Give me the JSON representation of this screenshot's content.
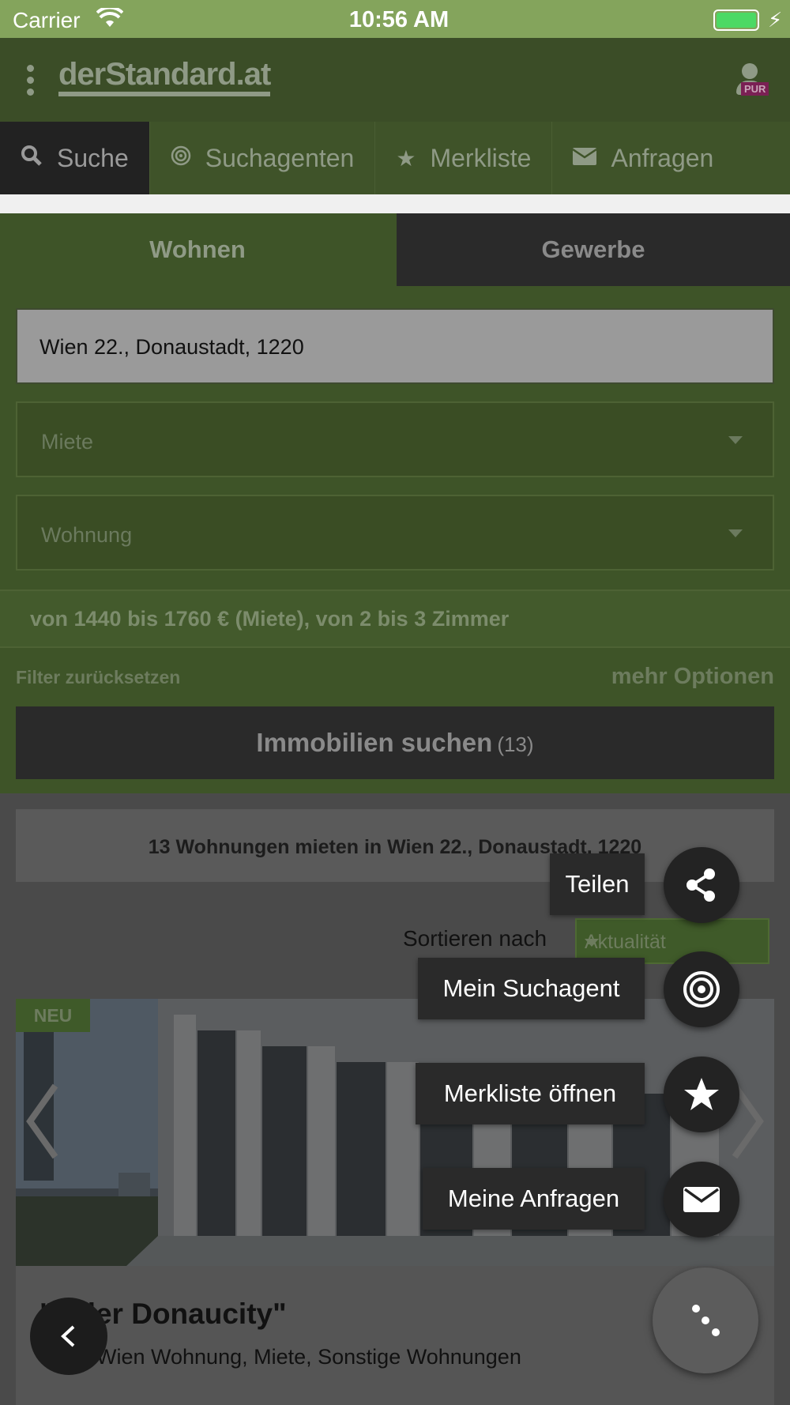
{
  "status_bar": {
    "carrier": "Carrier",
    "time": "10:56 AM"
  },
  "header": {
    "logo": "derStandard.at",
    "user_badge": "PUR"
  },
  "tabs": [
    {
      "label": "Suche",
      "icon": "search-icon",
      "active": true
    },
    {
      "label": "Suchagenten",
      "icon": "target-icon",
      "active": false
    },
    {
      "label": "Merkliste",
      "icon": "star-icon",
      "active": false
    },
    {
      "label": "Anfragen",
      "icon": "envelope-icon",
      "active": false
    }
  ],
  "search": {
    "segments": {
      "wohnen": "Wohnen",
      "gewerbe": "Gewerbe",
      "selected": "Wohnen"
    },
    "location": "Wien 22., Donaustadt, 1220",
    "type_select": "Miete",
    "category_select": "Wohnung",
    "filter_summary": "von 1440 bis 1760 € (Miete), von 2 bis 3 Zimmer",
    "reset_label": "Filter zurücksetzen",
    "more_label": "mehr Optionen",
    "submit_label": "Immobilien suchen",
    "submit_count": "(13)"
  },
  "results": {
    "heading": "13 Wohnungen mieten in Wien 22., Donaustadt, 1220",
    "sort_label": "Sortieren nach",
    "sort_value": "Aktualität",
    "listing": {
      "badge": "NEU",
      "title": "\"...der Donaucity\"",
      "subtitle": "Wien Wohnung, Miete, Sonstige Wohnungen"
    }
  },
  "action_menu": [
    {
      "label": "Teilen",
      "icon": "share-icon"
    },
    {
      "label": "Mein Suchagent",
      "icon": "target-icon"
    },
    {
      "label": "Merkliste öffnen",
      "icon": "star-icon"
    },
    {
      "label": "Meine Anfragen",
      "icon": "envelope-icon"
    }
  ],
  "colors": {
    "status_bar": "#84a45c",
    "brand_green": "#3e5428",
    "overlay_dark": "#2a2a2a",
    "battery": "#4cd964"
  }
}
